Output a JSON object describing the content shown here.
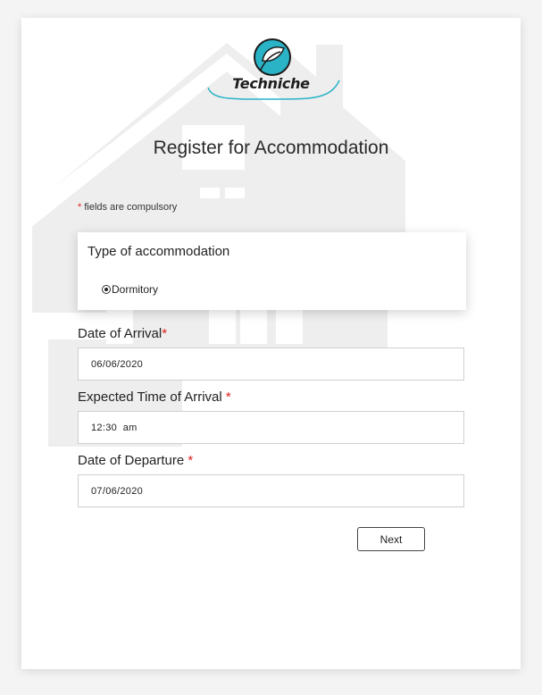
{
  "logo": {
    "text": "Techniche"
  },
  "page": {
    "title": "Register for Accommodation"
  },
  "note": {
    "asterisk": "*",
    "text": "fields are compulsory"
  },
  "accommodation": {
    "title": "Type of accommodation",
    "options": [
      {
        "label": "Dormitory",
        "selected": true
      }
    ]
  },
  "fields": {
    "arrival_date": {
      "label": "Date of Arrival",
      "required_mark": "*",
      "value": "06/06/2020"
    },
    "arrival_time": {
      "label": "Expected Time of Arrival",
      "required_mark": "*",
      "value": "12:30  am"
    },
    "departure_date": {
      "label": "Date of Departure",
      "required_mark": "*",
      "value": "07/06/2020"
    }
  },
  "actions": {
    "next_label": "Next"
  },
  "colors": {
    "accent_teal": "#2ab3c7",
    "required_red": "#e01e1e"
  }
}
